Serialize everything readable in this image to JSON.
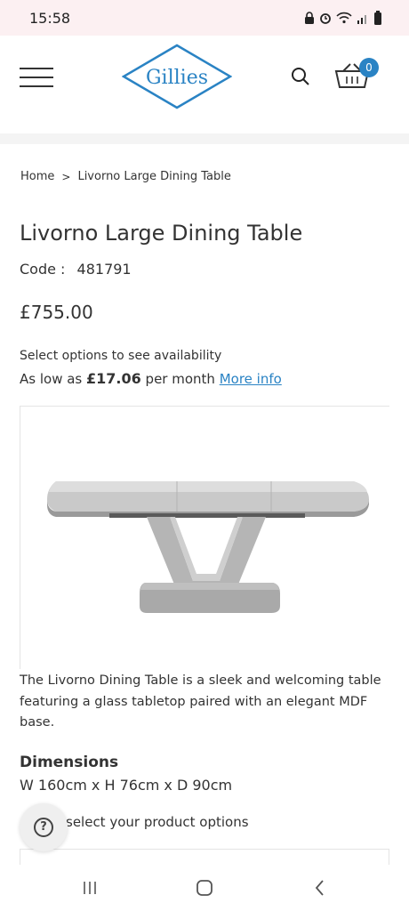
{
  "status_bar": {
    "time": "15:58",
    "icons": [
      "lock-icon",
      "alarm-icon",
      "wifi-icon",
      "signal-icon",
      "battery-icon"
    ]
  },
  "header": {
    "logo_text": "Gillies",
    "cart_count": "0",
    "menu_icon": "hamburger-icon",
    "search_icon": "search-icon",
    "cart_icon": "basket-icon",
    "brand_color": "#2a83c4"
  },
  "breadcrumb": {
    "home": "Home",
    "separator": ">",
    "current": "Livorno Large Dining Table"
  },
  "product": {
    "title": "Livorno Large Dining Table",
    "code_label": "Code :",
    "code_value": "481791",
    "price": "£755.00",
    "availability": "Select options to see availability",
    "finance_prefix": "As low as",
    "finance_amount": "£17.06",
    "finance_suffix": "per month",
    "finance_link": "More info",
    "description": "The Livorno Dining Table is a sleek and welcoming table featuring a glass tabletop paired with an elegant MDF base."
  },
  "dimensions": {
    "heading": "Dimensions",
    "value": "W 160cm x H 76cm x D 90cm"
  },
  "options": {
    "prompt": "select your product options"
  },
  "help": {
    "icon": "question-icon",
    "label": "?"
  },
  "nav_bar": {
    "icons": [
      "recents-icon",
      "home-icon",
      "back-icon"
    ]
  }
}
